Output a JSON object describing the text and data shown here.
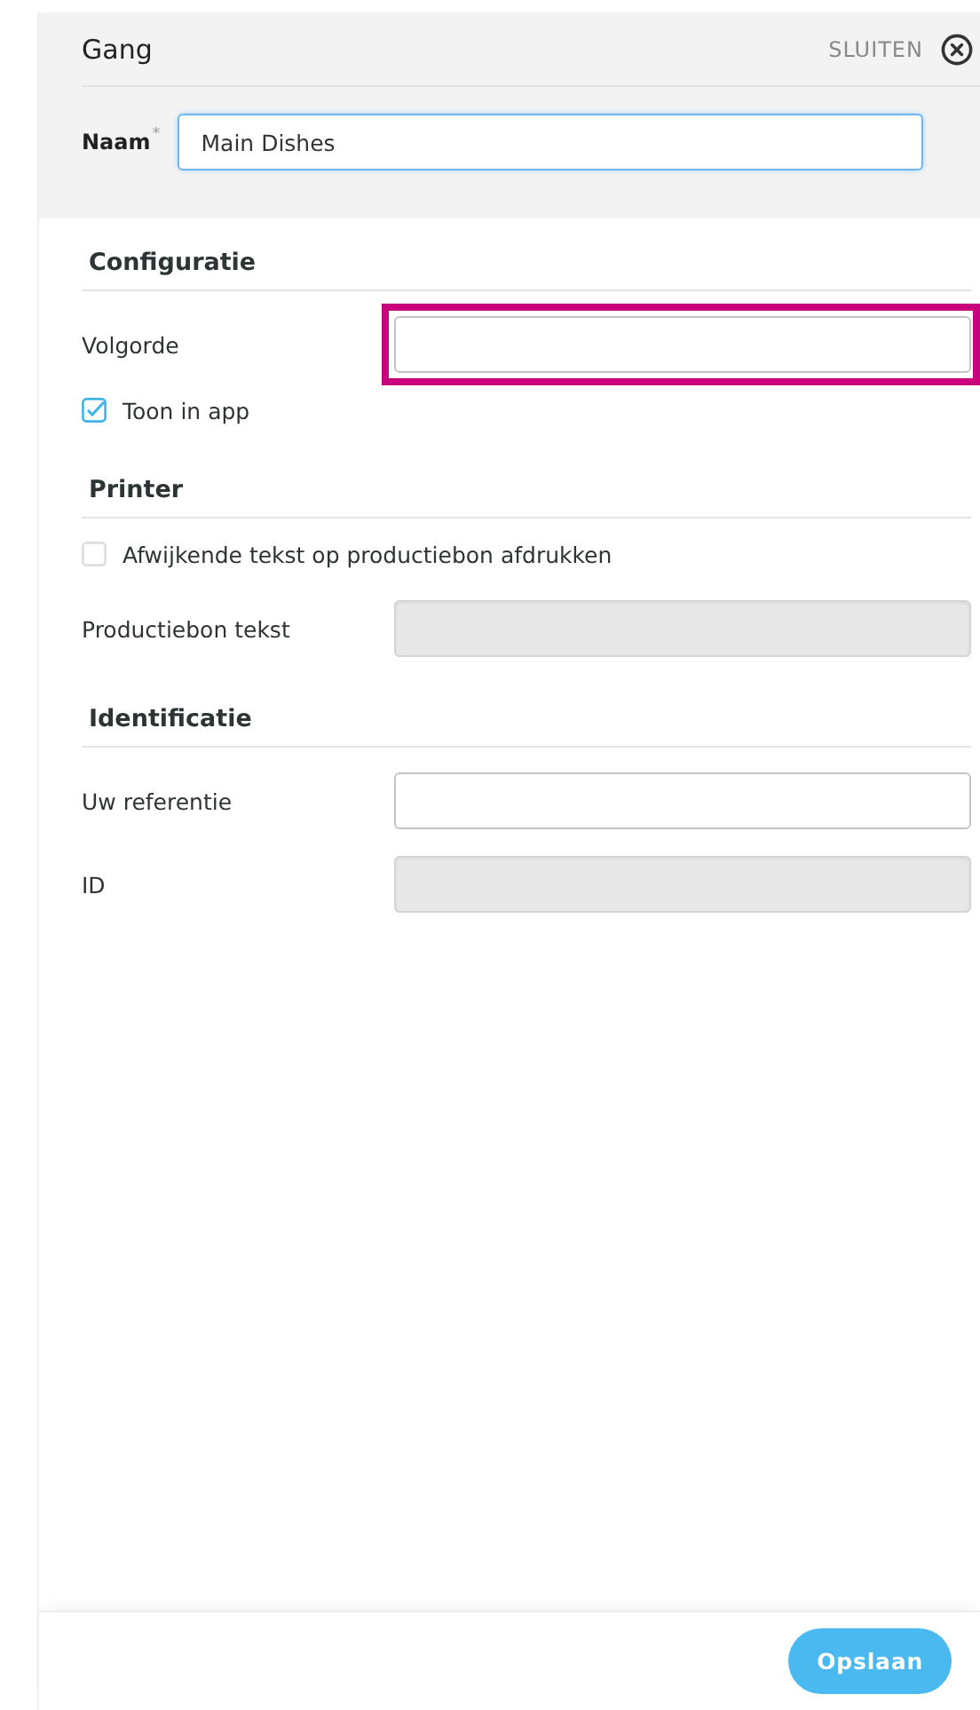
{
  "panel": {
    "title": "Gang",
    "close_label": "SLUITEN"
  },
  "name_field": {
    "label": "Naam",
    "required_mark": "*",
    "value": "Main Dishes",
    "focused": true
  },
  "sections": [
    {
      "title": "Configuratie",
      "items": [
        {
          "kind": "field",
          "label": "Volgorde",
          "disabled": false,
          "highlighted": true
        },
        {
          "kind": "checkbox",
          "label": "Toon in app",
          "checked": true
        }
      ]
    },
    {
      "title": "Printer",
      "items": [
        {
          "kind": "checkbox",
          "label": "Afwijkende tekst op productiebon afdrukken",
          "checked": false
        },
        {
          "kind": "field",
          "label": "Productiebon tekst",
          "disabled": true,
          "highlighted": false
        }
      ]
    },
    {
      "title": "Identificatie",
      "items": [
        {
          "kind": "field",
          "label": "Uw referentie",
          "disabled": false,
          "highlighted": false
        },
        {
          "kind": "field",
          "label": "ID",
          "disabled": true,
          "highlighted": false
        }
      ]
    }
  ],
  "save_button": "Opslaan"
}
